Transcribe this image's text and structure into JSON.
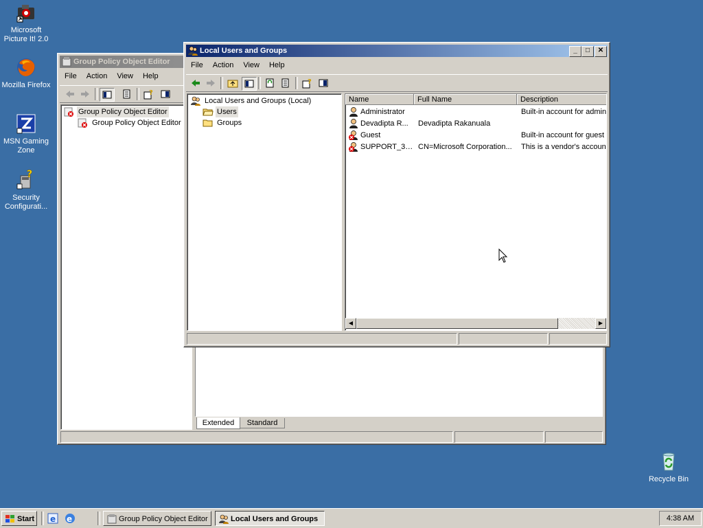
{
  "desktop": {
    "icons": [
      {
        "label": "Microsoft Picture It! 2.0"
      },
      {
        "label": "Mozilla Firefox"
      },
      {
        "label": "MSN Gaming Zone"
      },
      {
        "label": "Security Configurati..."
      },
      {
        "label": "Recycle Bin"
      }
    ]
  },
  "gpo_window": {
    "title": "Group Policy Object Editor",
    "menu": [
      "File",
      "Action",
      "View",
      "Help"
    ],
    "tree": [
      "Group Policy Object Editor",
      "Group Policy Object Editor"
    ],
    "tabs": [
      "Extended",
      "Standard"
    ]
  },
  "lug_window": {
    "title": "Local Users and Groups",
    "menu": [
      "File",
      "Action",
      "View",
      "Help"
    ],
    "tree": {
      "root": "Local Users and Groups (Local)",
      "children": [
        "Users",
        "Groups"
      ]
    },
    "columns": [
      "Name",
      "Full Name",
      "Description"
    ],
    "rows": [
      {
        "name": "Administrator",
        "full_name": "",
        "description": "Built-in account for adminis"
      },
      {
        "name": "Devadipta R...",
        "full_name": "Devadipta Rakanuala",
        "description": ""
      },
      {
        "name": "Guest",
        "full_name": "",
        "description": "Built-in account for guest a"
      },
      {
        "name": "SUPPORT_38...",
        "full_name": "CN=Microsoft Corporation...",
        "description": "This is a vendor's account"
      }
    ]
  },
  "taskbar": {
    "start_label": "Start",
    "buttons": [
      "Group Policy Object Editor",
      "Local Users and Groups"
    ],
    "clock": "4:38 AM"
  },
  "colors": {
    "desktop": "#3a6ea5",
    "title_active": "#0a246a",
    "title_inactive": "#808080",
    "face": "#d4d0c8"
  }
}
